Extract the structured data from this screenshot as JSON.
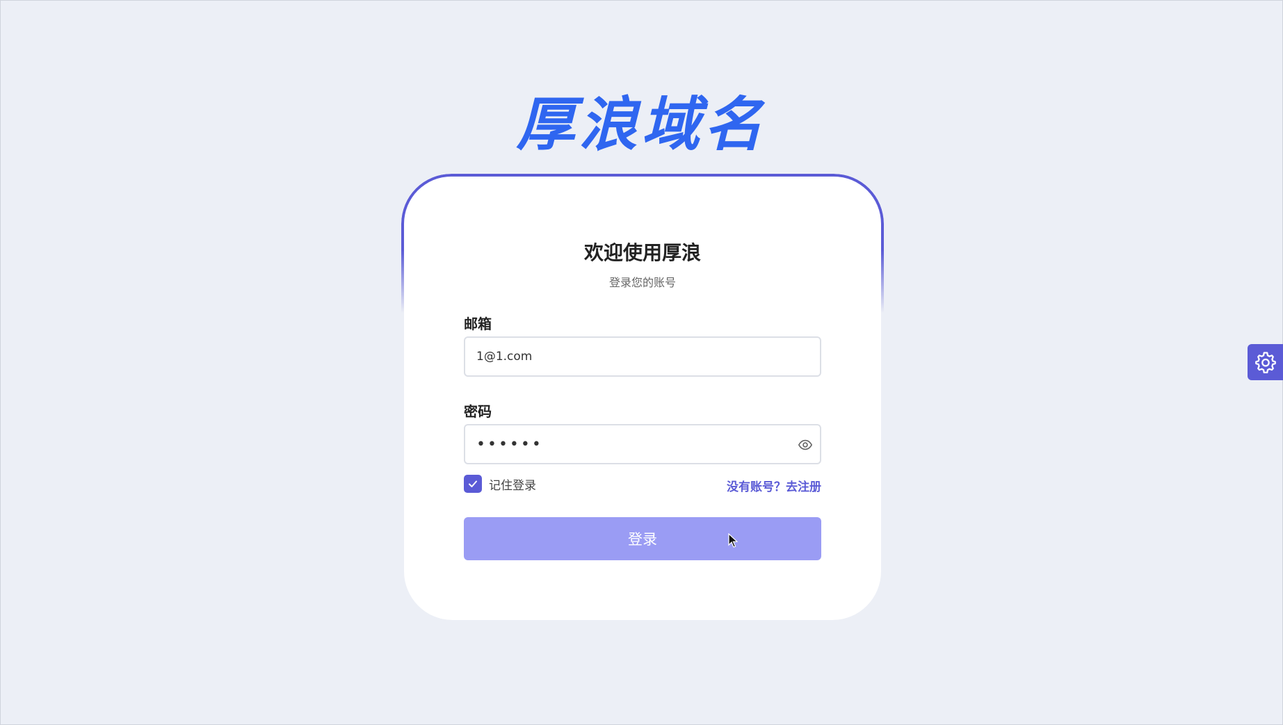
{
  "brand": {
    "title": "厚浪域名"
  },
  "login_card": {
    "welcome": "欢迎使用厚浪",
    "subtitle": "登录您的账号",
    "email": {
      "label": "邮箱",
      "value": "1@1.com",
      "placeholder": ""
    },
    "password": {
      "label": "密码",
      "value": "••••••",
      "toggle_icon": "eye-icon"
    },
    "remember": {
      "label": "记住登录",
      "checked": true
    },
    "register_link": "没有账号？去注册",
    "login_button": "登录"
  },
  "settings_fab": {
    "icon": "gear-icon"
  },
  "colors": {
    "brand_blue": "#2f66f0",
    "accent": "#5b5bd6",
    "button_bg": "#9a9cf4",
    "page_bg": "#eceff6"
  }
}
